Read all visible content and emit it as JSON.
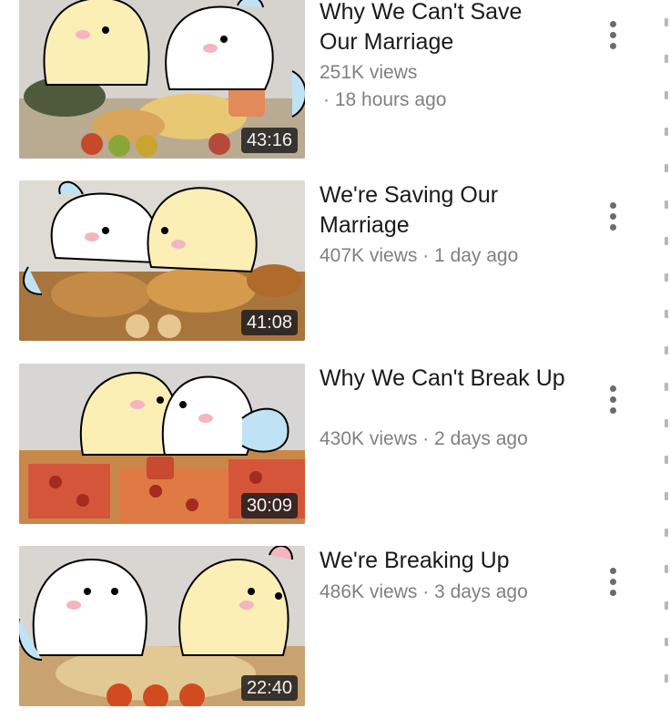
{
  "videos": [
    {
      "title": "Why We Can't Save Our Marriage",
      "views": "251K views",
      "dot_age": "· 18 hours ago",
      "duration": "43:16",
      "menu_icon": "more-vert-icon"
    },
    {
      "title": "We're Saving Our Marriage",
      "meta": "407K views · 1 day ago",
      "duration": "41:08",
      "menu_icon": "more-vert-icon"
    },
    {
      "title": "Why We Can't Break Up",
      "meta": "430K views · 2 days ago",
      "duration": "30:09",
      "menu_icon": "more-vert-icon"
    },
    {
      "title": "We're Breaking Up",
      "meta": "486K views · 3 days ago",
      "duration": "22:40",
      "menu_icon": "more-vert-icon"
    }
  ],
  "colors": {
    "title": "#1a1a1a",
    "meta": "#808080",
    "duration_bg": "#1e1e1e",
    "yellow_character": "#fbefb6",
    "white_character": "#ffffff",
    "blue_accent": "#bfe3f5",
    "blush": "#f5b5c0"
  }
}
